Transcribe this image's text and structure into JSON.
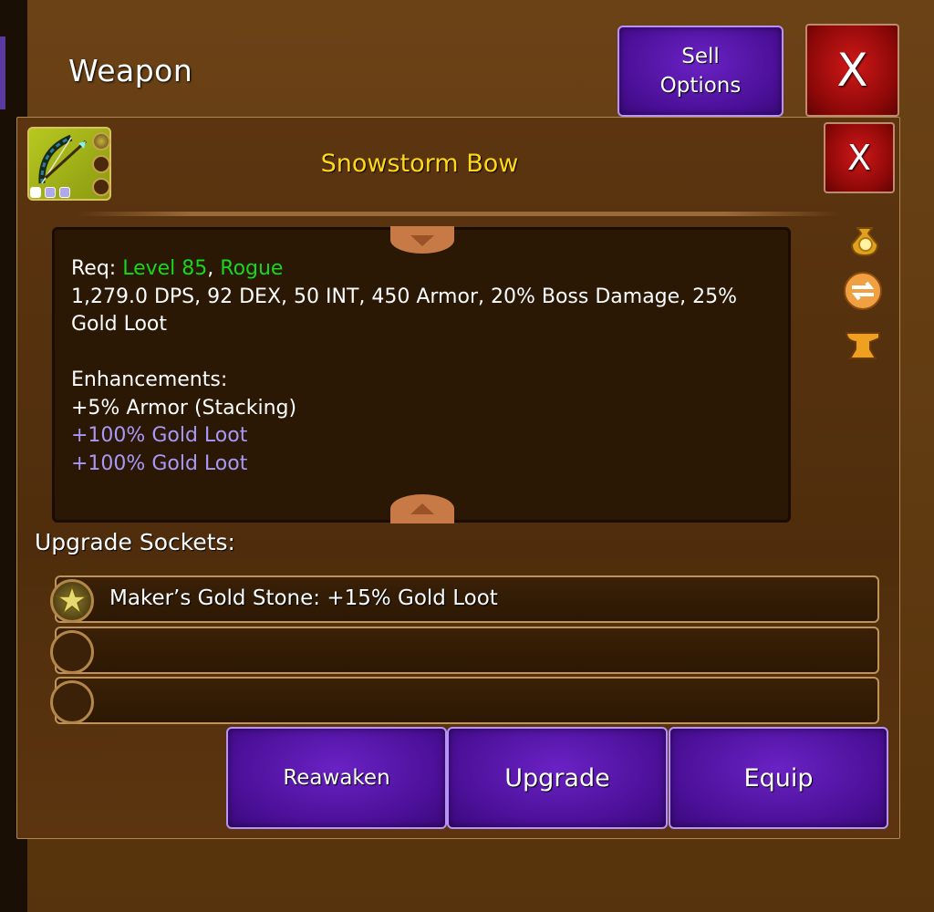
{
  "window": {
    "title": "Weapon",
    "sell_label_line1": "Sell",
    "sell_label_line2": "Options",
    "close_label": "X"
  },
  "item": {
    "name": "Snowstorm Bow",
    "close_label": "X",
    "name_color": "#ffd81a",
    "icon": "bow-icon"
  },
  "description": {
    "req_prefix": "Req: ",
    "req_level": "Level 85",
    "req_sep": ", ",
    "req_class": "Rogue",
    "stats": "1,279.0 DPS, 92 DEX, 50 INT, 450 Armor, 20% Boss Damage, 25% Gold Loot",
    "enhancements_header": "Enhancements:",
    "enhancements": [
      "+5% Armor (Stacking)",
      "+100% Gold Loot",
      "+100% Gold Loot"
    ],
    "req_color": "#18d818",
    "bonus_color": "#a898f8"
  },
  "side_icons": [
    "gold-bag-icon",
    "reroll-icon",
    "anvil-icon"
  ],
  "sockets": {
    "label": "Upgrade Sockets:",
    "slots": [
      {
        "text": "Maker’s Gold Stone: +15% Gold Loot",
        "filled": true
      },
      {
        "text": "",
        "filled": false
      },
      {
        "text": "",
        "filled": false
      }
    ]
  },
  "actions": {
    "reawaken": "Reawaken",
    "upgrade": "Upgrade",
    "equip": "Equip"
  }
}
